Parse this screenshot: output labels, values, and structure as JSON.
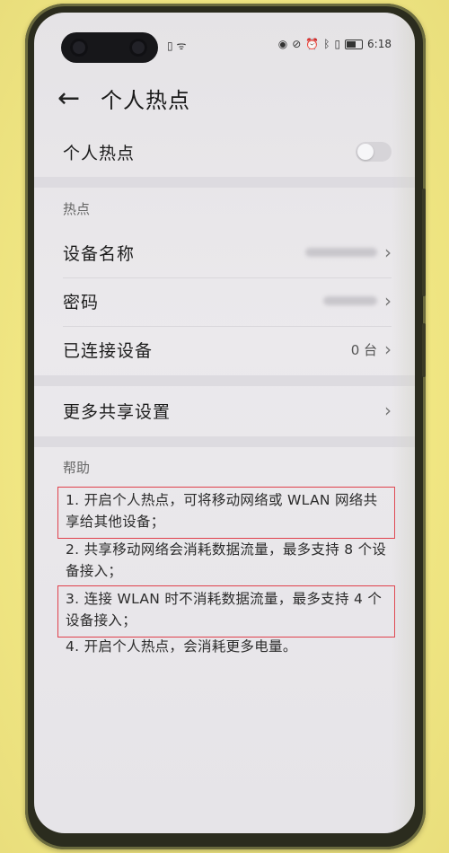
{
  "status_bar": {
    "time": "6:18"
  },
  "header": {
    "back_icon": "arrow-left-icon",
    "title": "个人热点"
  },
  "hotspot_toggle": {
    "label": "个人热点",
    "enabled": false
  },
  "hotspot_section": {
    "heading": "热点",
    "device_name_label": "设备名称",
    "password_label": "密码",
    "connected_devices_label": "已连接设备",
    "connected_devices_value": "0 台"
  },
  "more_settings": {
    "label": "更多共享设置"
  },
  "help": {
    "heading": "帮助",
    "items": [
      "1. 开启个人热点，可将移动网络或 WLAN 网络共享给其他设备；",
      "2. 共享移动网络会消耗数据流量，最多支持 8 个设备接入；",
      "3. 连接 WLAN 时不消耗数据流量，最多支持 4 个设备接入；",
      "4. 开启个人热点，会消耗更多电量。"
    ],
    "highlight_color": "#e0404b"
  }
}
